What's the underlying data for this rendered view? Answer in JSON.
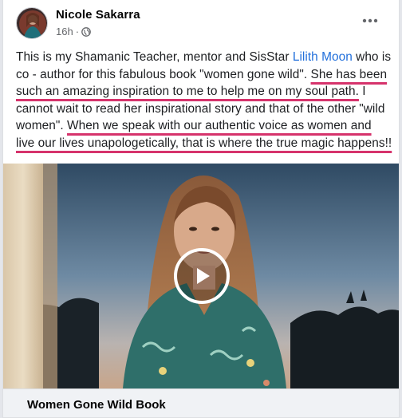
{
  "post": {
    "author": "Nicole Sakarra",
    "timestamp": "16h",
    "separator": "·",
    "privacy_icon": "globe-icon",
    "more_icon": "more-horizontal-icon",
    "text_segments": [
      {
        "text": "This is my Shamanic Teacher, mentor and SisStar ",
        "style": "plain"
      },
      {
        "text": "Lilith Moon",
        "style": "link"
      },
      {
        "text": " who is co - author for this fabulous book \"women gone wild\". ",
        "style": "plain"
      },
      {
        "text": "She has been such an amazing inspiration to me to help me on my soul path.",
        "style": "underline"
      },
      {
        "text": " I cannot wait to read her inspirational story and that of the other \"wild women\".  ",
        "style": "plain"
      },
      {
        "text": "When we speak with our authentic voice as women and live our lives unapologetically, that is where the true magic happens!!",
        "style": "underline"
      }
    ],
    "video": {
      "play_icon": "play-icon"
    },
    "link_preview": {
      "title": "Women Gone Wild Book"
    }
  },
  "colors": {
    "link": "#216fdb",
    "underline": "#d6336c",
    "secondary_text": "#65676b"
  }
}
